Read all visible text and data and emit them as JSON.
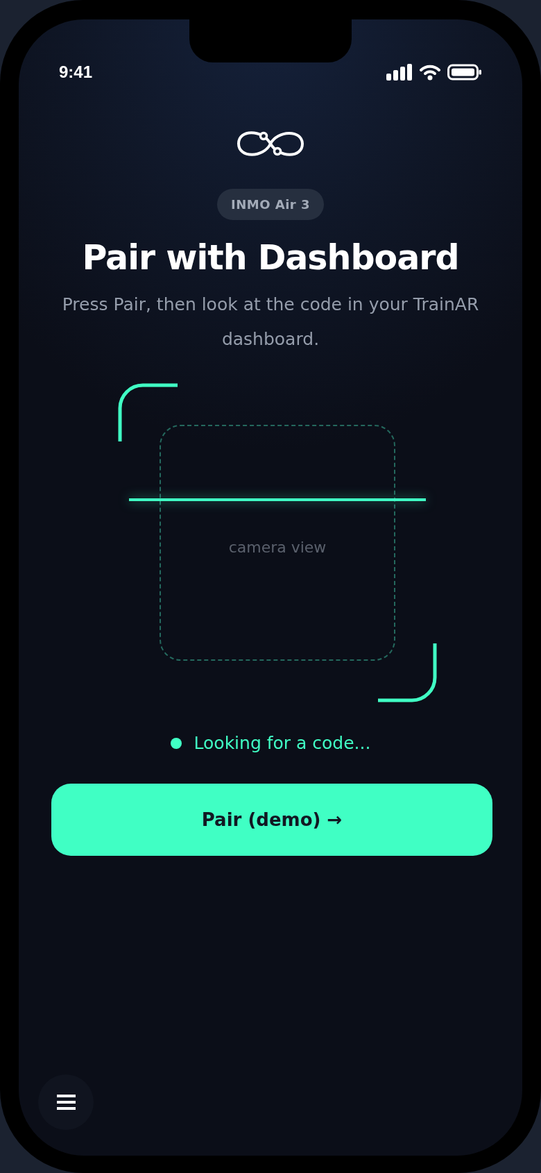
{
  "status_bar": {
    "time": "9:41"
  },
  "header": {
    "badge": "INMO Air 3",
    "title": "Pair with Dashboard",
    "subtitle": "Press Pair, then look at the code in your TrainAR dashboard."
  },
  "scanner": {
    "label": "camera view"
  },
  "status": {
    "text": "Looking for a code..."
  },
  "primary_button": {
    "label": "Pair (demo) →"
  }
}
